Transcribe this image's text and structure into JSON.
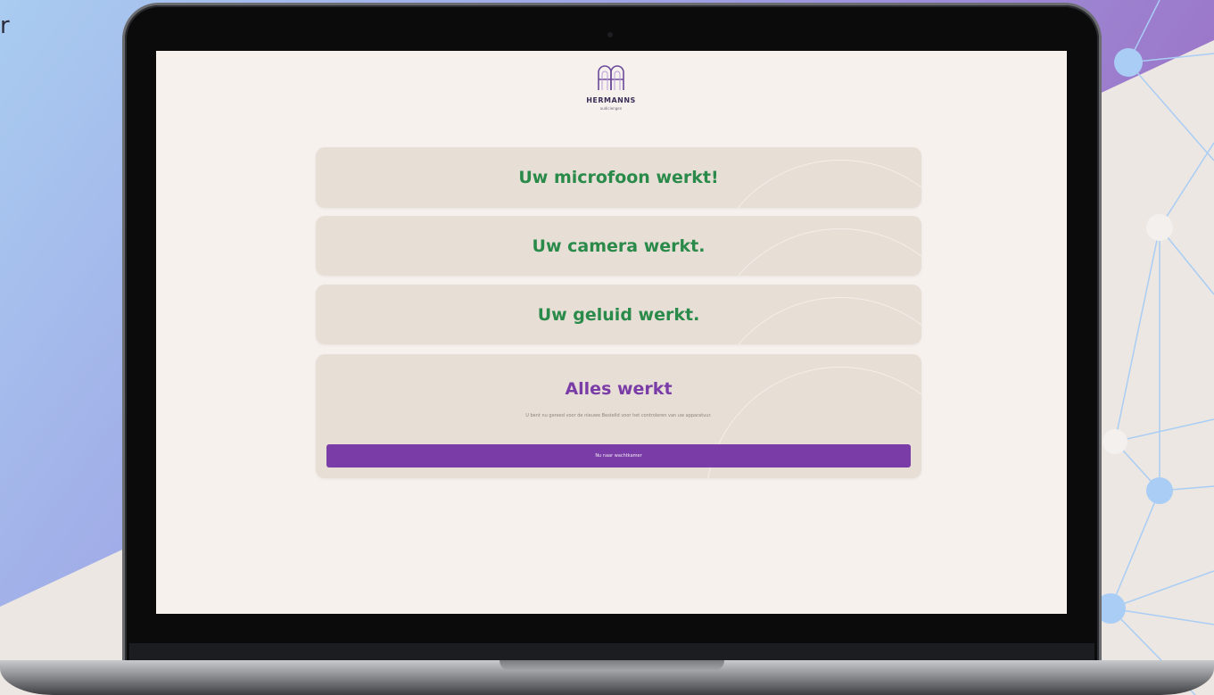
{
  "background": {
    "side_letter": "r"
  },
  "logo": {
    "name": "HERMANNS",
    "subtitle": "audiciengen"
  },
  "cards": [
    {
      "title": "Uw microfoon werkt!"
    },
    {
      "title": "Uw camera werkt."
    },
    {
      "title": "Uw geluid werkt."
    }
  ],
  "summary": {
    "title": "Alles werkt",
    "note": "U bent nu gereed voor de nieuwe Bestelld voor het controleren van uw apparatuur.",
    "button_label": "Nu naar wachtkamer"
  },
  "colors": {
    "success_text": "#2a8a4a",
    "accent_purple": "#7a3ca6",
    "screen_bg": "#f7f1ee",
    "card_bg": "#e7ded6"
  },
  "icons": {
    "logo": "hermanns-logo-icon"
  }
}
